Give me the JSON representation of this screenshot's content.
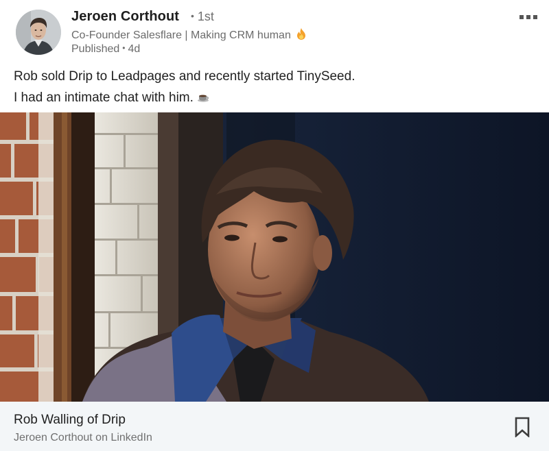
{
  "post": {
    "author": {
      "name": "Jeroen Corthout",
      "degree": "1st",
      "headline": "Co-Founder Salesflare | Making CRM human",
      "headline_emoji_icon": "fire-icon",
      "published_label": "Published",
      "published_age": "4d"
    },
    "more_icon": "more-options-icon",
    "text_lines": [
      "Rob sold Drip to Leadpages and recently started TinySeed.",
      "I had an intimate chat with him."
    ],
    "text_emoji_icon": "coffee-icon",
    "image_description_icon": "portrait-photo",
    "link_card": {
      "title": "Rob Walling of Drip",
      "subtitle": "Jeroen Corthout on LinkedIn",
      "save_icon": "bookmark-icon"
    }
  },
  "colors": {
    "name_text": "#1e1e1e",
    "secondary_text": "#6b6b6b",
    "link_card_bg": "#f3f6f8",
    "icon_grey": "#555555"
  }
}
